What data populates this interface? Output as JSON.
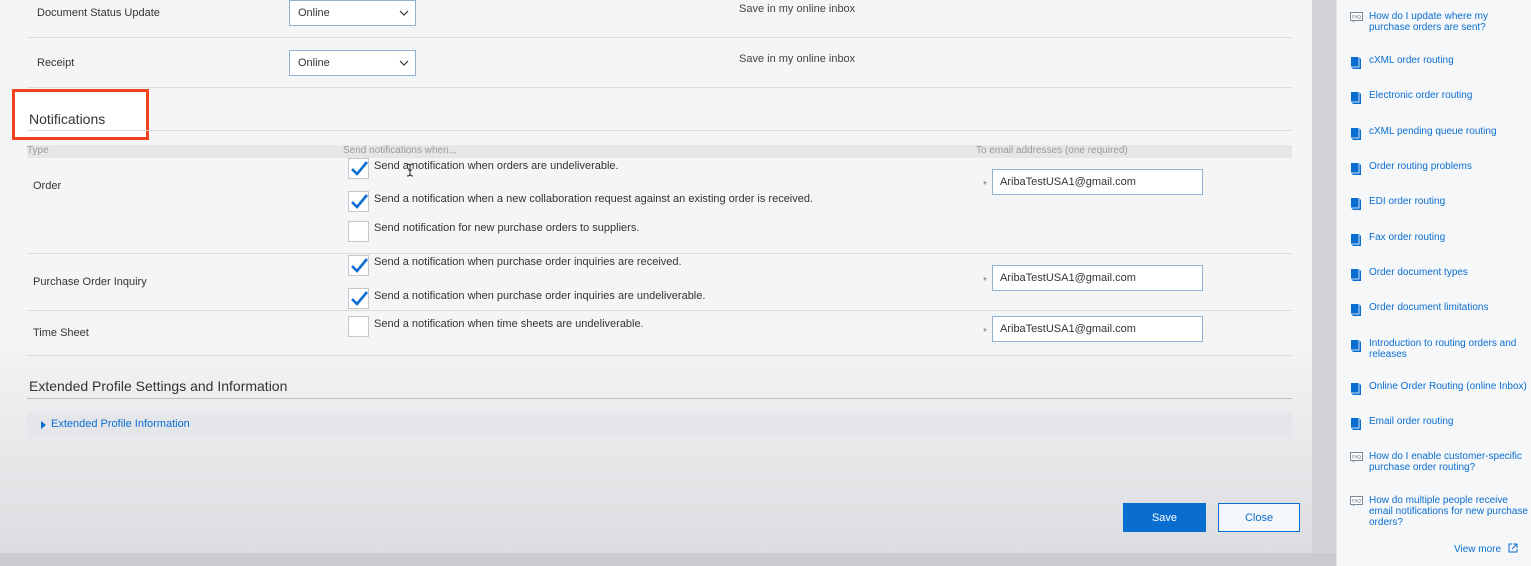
{
  "routing_rows": [
    {
      "label": "Document Status Update",
      "select_value": "Online",
      "note": "Save in my online inbox"
    },
    {
      "label": "Receipt",
      "select_value": "Online",
      "note": "Save in my online inbox"
    }
  ],
  "notifications": {
    "title": "Notifications",
    "headers": {
      "type": "Type",
      "send_when": "Send notifications when...",
      "to_email": "To email addresses (one required)"
    },
    "rows": [
      {
        "type": "Order",
        "email": "AribaTestUSA1@gmail.com",
        "options": [
          {
            "label": "Send a notification when orders are undeliverable.",
            "checked": true
          },
          {
            "label": "Send a notification when a new collaboration request against an existing order is received.",
            "checked": true
          },
          {
            "label": "Send notification for new purchase orders to suppliers.",
            "checked": false
          }
        ]
      },
      {
        "type": "Purchase Order Inquiry",
        "email": "AribaTestUSA1@gmail.com",
        "options": [
          {
            "label": "Send a notification when purchase order inquiries are received.",
            "checked": true
          },
          {
            "label": "Send a notification when purchase order inquiries are undeliverable.",
            "checked": true
          }
        ]
      },
      {
        "type": "Time Sheet",
        "email": "AribaTestUSA1@gmail.com",
        "options": [
          {
            "label": "Send a notification when time sheets are undeliverable.",
            "checked": false
          }
        ]
      }
    ],
    "required_marker": "*"
  },
  "extended": {
    "title": "Extended Profile Settings and Information",
    "expander_label": "Extended Profile Information"
  },
  "actions": {
    "save": "Save",
    "close": "Close"
  },
  "help_panel": {
    "items": [
      {
        "icon": "faq-icon",
        "text": "How do I update where my purchase orders are sent?"
      },
      {
        "icon": "book-icon",
        "text": "cXML order routing"
      },
      {
        "icon": "book-icon",
        "text": "Electronic order routing"
      },
      {
        "icon": "book-icon",
        "text": "cXML pending queue routing"
      },
      {
        "icon": "book-icon",
        "text": "Order routing problems"
      },
      {
        "icon": "book-icon",
        "text": "EDI order routing"
      },
      {
        "icon": "book-icon",
        "text": "Fax order routing"
      },
      {
        "icon": "book-icon",
        "text": "Order document types"
      },
      {
        "icon": "book-icon",
        "text": "Order document limitations"
      },
      {
        "icon": "book-icon",
        "text": "Introduction to routing orders and releases"
      },
      {
        "icon": "book-icon",
        "text": "Online Order Routing (online Inbox)"
      },
      {
        "icon": "book-icon",
        "text": "Email order routing"
      },
      {
        "icon": "faq-icon",
        "text": "How do I enable customer-specific purchase order routing?"
      },
      {
        "icon": "faq-icon",
        "text": "How do multiple people receive email notifications for new purchase orders?"
      }
    ],
    "view_more": "View more"
  },
  "colors": {
    "accent": "#0a6ed1",
    "highlight_box": "#f0431b"
  }
}
